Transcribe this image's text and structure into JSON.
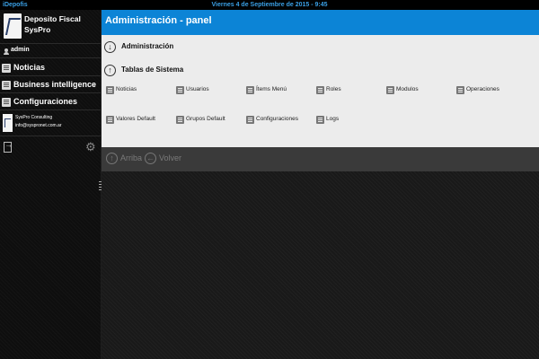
{
  "status_bar": {
    "app_name": "iDepofis",
    "datetime": "Viernes 4 de Septiembre de 2015 - 9:45"
  },
  "sidebar": {
    "brand": "Deposito Fiscal SysPro",
    "user": "admin",
    "items": [
      {
        "label": "Noticias",
        "icon": "list-icon"
      },
      {
        "label": "Business intelligence",
        "icon": "list-icon",
        "has_submenu": true
      },
      {
        "label": "Configuraciones",
        "icon": "list-icon"
      }
    ],
    "company": {
      "name": "SysPro Consulting",
      "email": "info@syspronet.com.ar"
    }
  },
  "header": {
    "title": "Administración - panel"
  },
  "panel": {
    "sections": [
      {
        "label": "Administración",
        "icon": "arrow-down-circle-icon"
      },
      {
        "label": "Tablas de Sistema",
        "icon": "arrow-up-circle-icon"
      }
    ],
    "links": [
      "Noticias",
      "Usuarios",
      "Ítems Menú",
      "Roles",
      "Modulos",
      "Operaciones",
      "Valores Default",
      "Grupos Default",
      "Configuraciones",
      "Logs"
    ]
  },
  "footer": {
    "up_label": "Arriba",
    "back_label": "Volver"
  },
  "colors": {
    "header": "#0c84d6",
    "panel": "#ececec",
    "status_text": "#3aa0e6",
    "sidebar": "#111111"
  }
}
